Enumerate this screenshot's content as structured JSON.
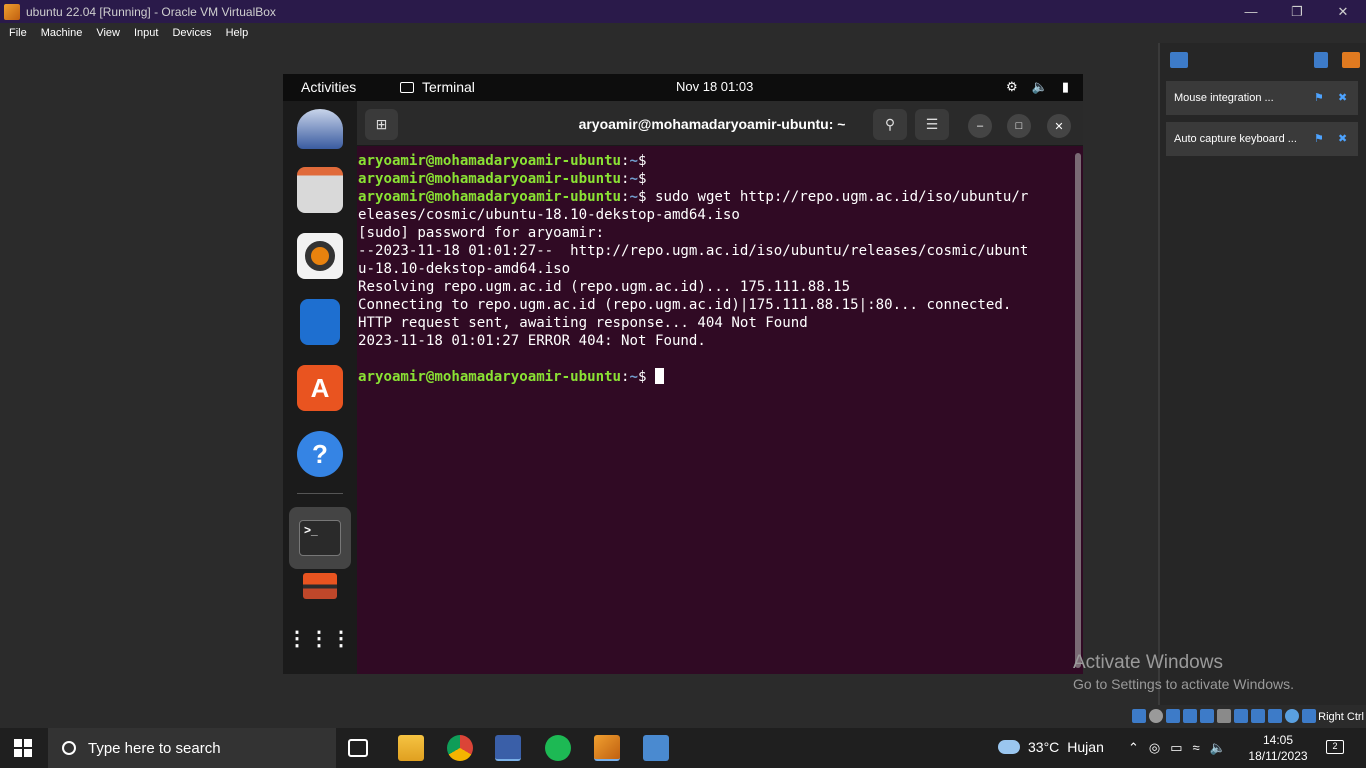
{
  "vbox": {
    "title": "ubuntu 22.04 [Running] - Oracle VM VirtualBox",
    "menu": [
      "File",
      "Machine",
      "View",
      "Input",
      "Devices",
      "Help"
    ],
    "host_key": "Right Ctrl"
  },
  "notifications": [
    {
      "label": "Mouse integration ..."
    },
    {
      "label": "Auto capture keyboard ..."
    }
  ],
  "ubuntu": {
    "activities": "Activities",
    "app_name": "Terminal",
    "clock": "Nov 18  01:03"
  },
  "terminal": {
    "title": "aryoamir@mohamadaryoamir-ubuntu: ~",
    "prompt_user": "aryoamir@mohamadaryoamir-ubuntu",
    "prompt_colon": ":",
    "prompt_dir": "~",
    "prompt_symbol": "$ ",
    "command": "sudo wget http://repo.ugm.ac.id/iso/ubuntu/r",
    "output": [
      "eleases/cosmic/ubuntu-18.10-dekstop-amd64.iso",
      "[sudo] password for aryoamir:",
      "--2023-11-18 01:01:27--  http://repo.ugm.ac.id/iso/ubuntu/releases/cosmic/ubunt",
      "u-18.10-dekstop-amd64.iso",
      "Resolving repo.ugm.ac.id (repo.ugm.ac.id)... 175.111.88.15",
      "Connecting to repo.ugm.ac.id (repo.ugm.ac.id)|175.111.88.15|:80... connected.",
      "HTTP request sent, awaiting response... 404 Not Found",
      "2023-11-18 01:01:27 ERROR 404: Not Found.",
      ""
    ]
  },
  "watermark": {
    "line1": "Activate Windows",
    "line2": "Go to Settings to activate Windows."
  },
  "taskbar": {
    "search_placeholder": "Type here to search",
    "temperature": "33°C",
    "weather": "Hujan",
    "time": "14:05",
    "date": "18/11/2023",
    "notification_count": "2"
  }
}
